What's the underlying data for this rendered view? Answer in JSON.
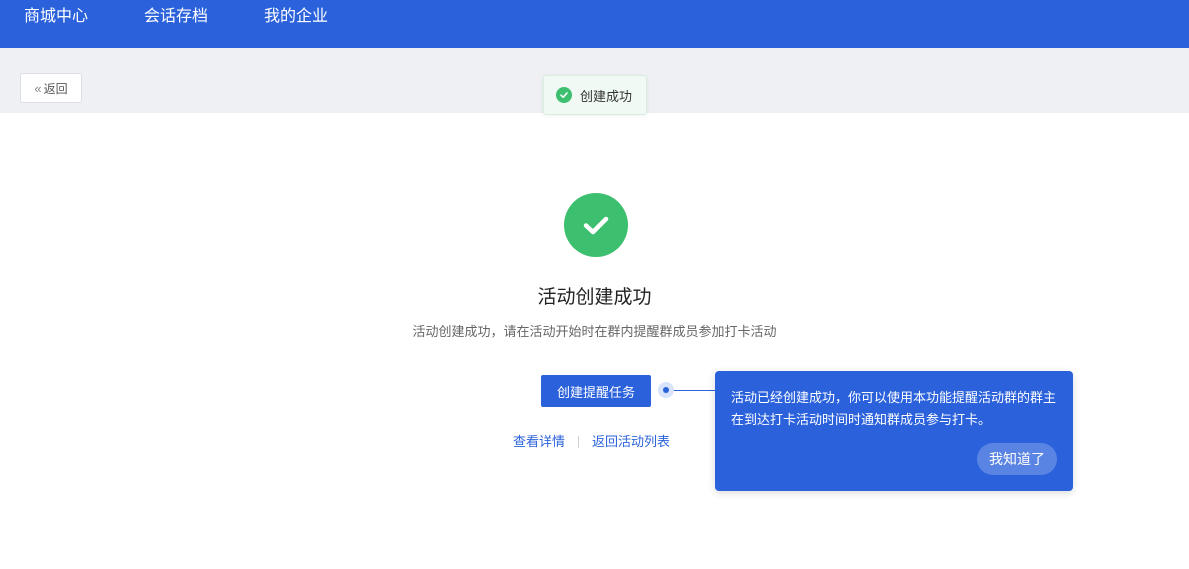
{
  "nav": {
    "items": [
      {
        "label": "商城中心"
      },
      {
        "label": "会话存档"
      },
      {
        "label": "我的企业"
      }
    ]
  },
  "toolbar": {
    "back_label": "返回"
  },
  "toast": {
    "text": "创建成功"
  },
  "result": {
    "title": "活动创建成功",
    "subtitle": "活动创建成功，请在活动开始时在群内提醒群成员参加打卡活动",
    "primary_button": "创建提醒任务",
    "links": [
      "查看详情",
      "返回活动列表"
    ]
  },
  "guide": {
    "text": "活动已经创建成功，你可以使用本功能提醒活动群的群主在到达打卡活动时间时通知群成员参与打卡。",
    "button": "我知道了"
  },
  "colors": {
    "primary": "#2b62dc",
    "success": "#3cbf6e",
    "subbar_bg": "#eef0f3"
  },
  "icons": [
    "success-check-icon",
    "double-chevron-left-icon"
  ]
}
